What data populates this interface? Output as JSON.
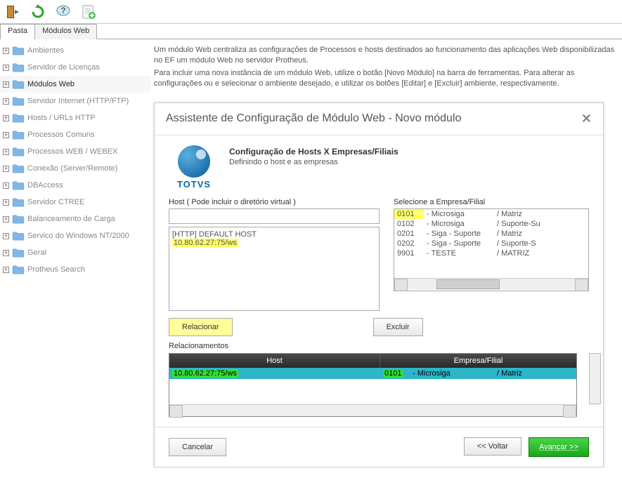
{
  "toolbar": {
    "icons": [
      "exit-icon",
      "refresh-icon",
      "help-icon",
      "new-module-icon"
    ]
  },
  "tabs": {
    "pasta": "Pasta",
    "modulos": "Módulos Web"
  },
  "tree": [
    "Ambientes",
    "Servidor de Licenças",
    "Módulos Web",
    "Servidor Internet (HTTP/FTP)",
    "Hosts / URLs HTTP",
    "Processos Comuns",
    "Processos WEB / WEBEX",
    "Conexão (Server/Remote)",
    "DBAccess",
    "Servidor CTREE",
    "Balanceamento de Carga",
    "Servico do Windows NT/2000",
    "Geral",
    "Protheus Search"
  ],
  "tree_selected_index": 2,
  "intro": {
    "p1": "Um módulo Web centraliza as configurações de Processos e hosts destinados ao funcionamento das aplicações Web disponibilizadas no EF um módulo Web no servidor Protheus.",
    "p2": "Para incluir uma nova instância de um módulo Web, utilize o botão [Novo Módulo] na barra de ferramentas. Para alterar as configurações ou e selecionar o ambiente desejado, e utilizar os botões [Editar] e [Excluir] ambiente, respectivamente."
  },
  "wizard": {
    "title": "Assistente de Configuração de Módulo Web - Novo módulo",
    "logo_text": "TOTVS",
    "heading": "Configuração de Hosts X Empresas/Filiais",
    "sub": "Definindo o host e as empresas",
    "host_label": "Host ( Pode incluir o diretório virtual )",
    "host_value": "",
    "host_list_line1": "[HTTP] DEFAULT HOST",
    "host_list_line2": "10.80.62.27:75/ws",
    "company_label": "Selecione a Empresa/Filial",
    "companies": [
      {
        "code": "0101",
        "name": "- Microsiga",
        "type": "/ Matriz"
      },
      {
        "code": "0102",
        "name": "- Microsiga",
        "type": "/ Suporte-Su"
      },
      {
        "code": "0201",
        "name": "- Siga - Suporte",
        "type": "/ Matriz"
      },
      {
        "code": "0202",
        "name": "- Siga - Suporte",
        "type": "/ Suporte-S"
      },
      {
        "code": "9901",
        "name": "- TESTE",
        "type": "/ MATRIZ"
      }
    ],
    "btn_relacionar": "Relacionar",
    "btn_excluir": "Excluir",
    "rel_label": "Relacionamentos",
    "rel_head_host": "Host",
    "rel_head_emp": "Empresa/Filial",
    "rel_row": {
      "host": "10.80.62.27:75/ws",
      "code": "0101",
      "name": "- Microsiga",
      "type": "/ Matriz"
    },
    "footer": {
      "cancel": "Cancelar",
      "back": "<< Voltar",
      "next": "Avançar >>"
    }
  }
}
